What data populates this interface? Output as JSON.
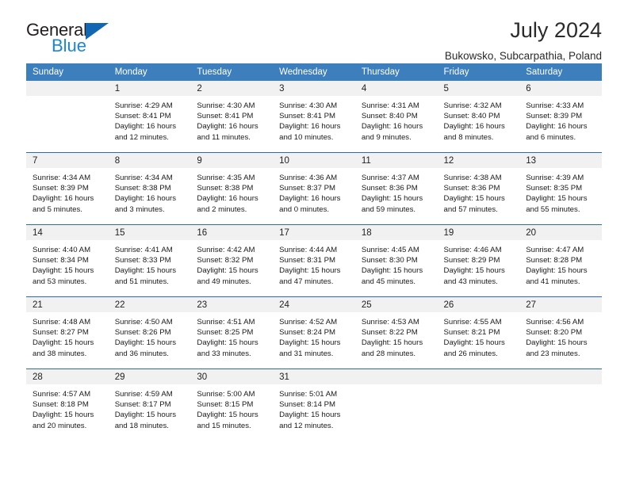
{
  "brand": {
    "word_one": "General",
    "word_two": "Blue",
    "triangle_icon": "brand-triangle-icon"
  },
  "header": {
    "title": "July 2024",
    "location": "Bukowsko, Subcarpathia, Poland"
  },
  "calendar": {
    "weekday_headers": [
      "Sunday",
      "Monday",
      "Tuesday",
      "Wednesday",
      "Thursday",
      "Friday",
      "Saturday"
    ],
    "colors": {
      "header_background": "#3d7ebd",
      "header_text": "#ffffff",
      "daynum_background": "#f1f1f1",
      "row_separator": "#2e6da4",
      "brand_blue": "#1b86d4",
      "brand_triangle": "#1267b2"
    },
    "weeks": [
      [
        {
          "day": "",
          "lines": []
        },
        {
          "day": "1",
          "lines": [
            "Sunrise: 4:29 AM",
            "Sunset: 8:41 PM",
            "Daylight: 16 hours",
            "and 12 minutes."
          ]
        },
        {
          "day": "2",
          "lines": [
            "Sunrise: 4:30 AM",
            "Sunset: 8:41 PM",
            "Daylight: 16 hours",
            "and 11 minutes."
          ]
        },
        {
          "day": "3",
          "lines": [
            "Sunrise: 4:30 AM",
            "Sunset: 8:41 PM",
            "Daylight: 16 hours",
            "and 10 minutes."
          ]
        },
        {
          "day": "4",
          "lines": [
            "Sunrise: 4:31 AM",
            "Sunset: 8:40 PM",
            "Daylight: 16 hours",
            "and 9 minutes."
          ]
        },
        {
          "day": "5",
          "lines": [
            "Sunrise: 4:32 AM",
            "Sunset: 8:40 PM",
            "Daylight: 16 hours",
            "and 8 minutes."
          ]
        },
        {
          "day": "6",
          "lines": [
            "Sunrise: 4:33 AM",
            "Sunset: 8:39 PM",
            "Daylight: 16 hours",
            "and 6 minutes."
          ]
        }
      ],
      [
        {
          "day": "7",
          "lines": [
            "Sunrise: 4:34 AM",
            "Sunset: 8:39 PM",
            "Daylight: 16 hours",
            "and 5 minutes."
          ]
        },
        {
          "day": "8",
          "lines": [
            "Sunrise: 4:34 AM",
            "Sunset: 8:38 PM",
            "Daylight: 16 hours",
            "and 3 minutes."
          ]
        },
        {
          "day": "9",
          "lines": [
            "Sunrise: 4:35 AM",
            "Sunset: 8:38 PM",
            "Daylight: 16 hours",
            "and 2 minutes."
          ]
        },
        {
          "day": "10",
          "lines": [
            "Sunrise: 4:36 AM",
            "Sunset: 8:37 PM",
            "Daylight: 16 hours",
            "and 0 minutes."
          ]
        },
        {
          "day": "11",
          "lines": [
            "Sunrise: 4:37 AM",
            "Sunset: 8:36 PM",
            "Daylight: 15 hours",
            "and 59 minutes."
          ]
        },
        {
          "day": "12",
          "lines": [
            "Sunrise: 4:38 AM",
            "Sunset: 8:36 PM",
            "Daylight: 15 hours",
            "and 57 minutes."
          ]
        },
        {
          "day": "13",
          "lines": [
            "Sunrise: 4:39 AM",
            "Sunset: 8:35 PM",
            "Daylight: 15 hours",
            "and 55 minutes."
          ]
        }
      ],
      [
        {
          "day": "14",
          "lines": [
            "Sunrise: 4:40 AM",
            "Sunset: 8:34 PM",
            "Daylight: 15 hours",
            "and 53 minutes."
          ]
        },
        {
          "day": "15",
          "lines": [
            "Sunrise: 4:41 AM",
            "Sunset: 8:33 PM",
            "Daylight: 15 hours",
            "and 51 minutes."
          ]
        },
        {
          "day": "16",
          "lines": [
            "Sunrise: 4:42 AM",
            "Sunset: 8:32 PM",
            "Daylight: 15 hours",
            "and 49 minutes."
          ]
        },
        {
          "day": "17",
          "lines": [
            "Sunrise: 4:44 AM",
            "Sunset: 8:31 PM",
            "Daylight: 15 hours",
            "and 47 minutes."
          ]
        },
        {
          "day": "18",
          "lines": [
            "Sunrise: 4:45 AM",
            "Sunset: 8:30 PM",
            "Daylight: 15 hours",
            "and 45 minutes."
          ]
        },
        {
          "day": "19",
          "lines": [
            "Sunrise: 4:46 AM",
            "Sunset: 8:29 PM",
            "Daylight: 15 hours",
            "and 43 minutes."
          ]
        },
        {
          "day": "20",
          "lines": [
            "Sunrise: 4:47 AM",
            "Sunset: 8:28 PM",
            "Daylight: 15 hours",
            "and 41 minutes."
          ]
        }
      ],
      [
        {
          "day": "21",
          "lines": [
            "Sunrise: 4:48 AM",
            "Sunset: 8:27 PM",
            "Daylight: 15 hours",
            "and 38 minutes."
          ]
        },
        {
          "day": "22",
          "lines": [
            "Sunrise: 4:50 AM",
            "Sunset: 8:26 PM",
            "Daylight: 15 hours",
            "and 36 minutes."
          ]
        },
        {
          "day": "23",
          "lines": [
            "Sunrise: 4:51 AM",
            "Sunset: 8:25 PM",
            "Daylight: 15 hours",
            "and 33 minutes."
          ]
        },
        {
          "day": "24",
          "lines": [
            "Sunrise: 4:52 AM",
            "Sunset: 8:24 PM",
            "Daylight: 15 hours",
            "and 31 minutes."
          ]
        },
        {
          "day": "25",
          "lines": [
            "Sunrise: 4:53 AM",
            "Sunset: 8:22 PM",
            "Daylight: 15 hours",
            "and 28 minutes."
          ]
        },
        {
          "day": "26",
          "lines": [
            "Sunrise: 4:55 AM",
            "Sunset: 8:21 PM",
            "Daylight: 15 hours",
            "and 26 minutes."
          ]
        },
        {
          "day": "27",
          "lines": [
            "Sunrise: 4:56 AM",
            "Sunset: 8:20 PM",
            "Daylight: 15 hours",
            "and 23 minutes."
          ]
        }
      ],
      [
        {
          "day": "28",
          "lines": [
            "Sunrise: 4:57 AM",
            "Sunset: 8:18 PM",
            "Daylight: 15 hours",
            "and 20 minutes."
          ]
        },
        {
          "day": "29",
          "lines": [
            "Sunrise: 4:59 AM",
            "Sunset: 8:17 PM",
            "Daylight: 15 hours",
            "and 18 minutes."
          ]
        },
        {
          "day": "30",
          "lines": [
            "Sunrise: 5:00 AM",
            "Sunset: 8:15 PM",
            "Daylight: 15 hours",
            "and 15 minutes."
          ]
        },
        {
          "day": "31",
          "lines": [
            "Sunrise: 5:01 AM",
            "Sunset: 8:14 PM",
            "Daylight: 15 hours",
            "and 12 minutes."
          ]
        },
        {
          "day": "",
          "lines": []
        },
        {
          "day": "",
          "lines": []
        },
        {
          "day": "",
          "lines": []
        }
      ]
    ]
  }
}
